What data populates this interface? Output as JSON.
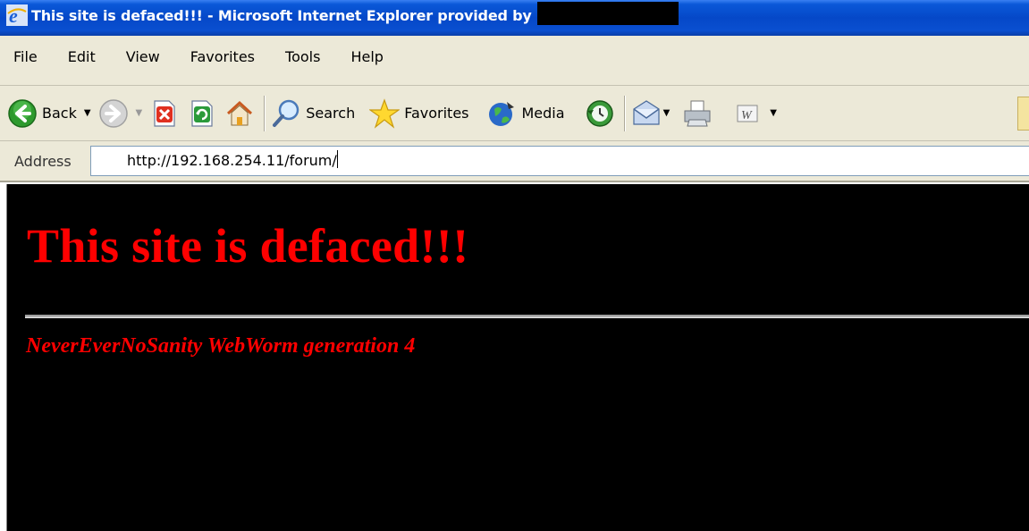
{
  "window": {
    "title": "This site is defaced!!! - Microsoft Internet Explorer provided by",
    "icon": "ie-icon",
    "title_bar_color": "#0548c8"
  },
  "menu": {
    "items": [
      "File",
      "Edit",
      "View",
      "Favorites",
      "Tools",
      "Help"
    ]
  },
  "toolbar": {
    "back_label": "Back",
    "search_label": "Search",
    "favorites_label": "Favorites",
    "media_label": "Media",
    "icons": [
      "back-icon",
      "forward-icon",
      "stop-icon",
      "refresh-icon",
      "home-icon",
      "search-icon",
      "favorites-star-icon",
      "media-icon",
      "history-icon",
      "mail-icon",
      "print-icon",
      "edit-word-icon"
    ]
  },
  "address": {
    "label": "Address",
    "value": "http://192.168.254.11/forum/"
  },
  "page": {
    "background": "#000000",
    "text_color": "#ff0000",
    "heading": "This site is defaced!!!",
    "subtext": "NeverEverNoSanity WebWorm generation 4"
  }
}
